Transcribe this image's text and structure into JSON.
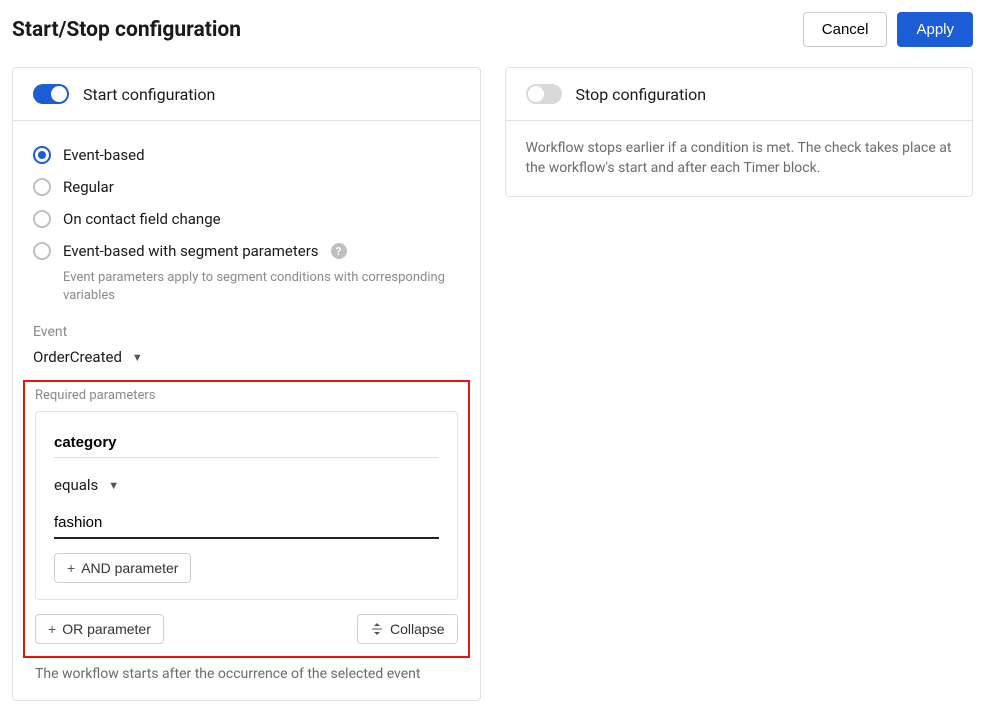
{
  "header": {
    "title": "Start/Stop configuration",
    "cancel": "Cancel",
    "apply": "Apply"
  },
  "start": {
    "title": "Start configuration",
    "options": {
      "event_based": "Event-based",
      "regular": "Regular",
      "on_field_change": "On contact field change",
      "event_based_segment": "Event-based with segment parameters",
      "event_based_segment_hint": "Event parameters apply to segment conditions with corresponding variables"
    },
    "event_label": "Event",
    "event_value": "OrderCreated",
    "params": {
      "section_label": "Required parameters",
      "key": "category",
      "operator": "equals",
      "value": "fashion",
      "and_btn": "AND parameter",
      "or_btn": "OR parameter",
      "collapse_btn": "Collapse"
    },
    "footnote": "The workflow starts after the occurrence of the selected event"
  },
  "stop": {
    "title": "Stop configuration",
    "note": "Workflow stops earlier if a condition is met. The check takes place at the workflow's start and after each Timer block."
  }
}
